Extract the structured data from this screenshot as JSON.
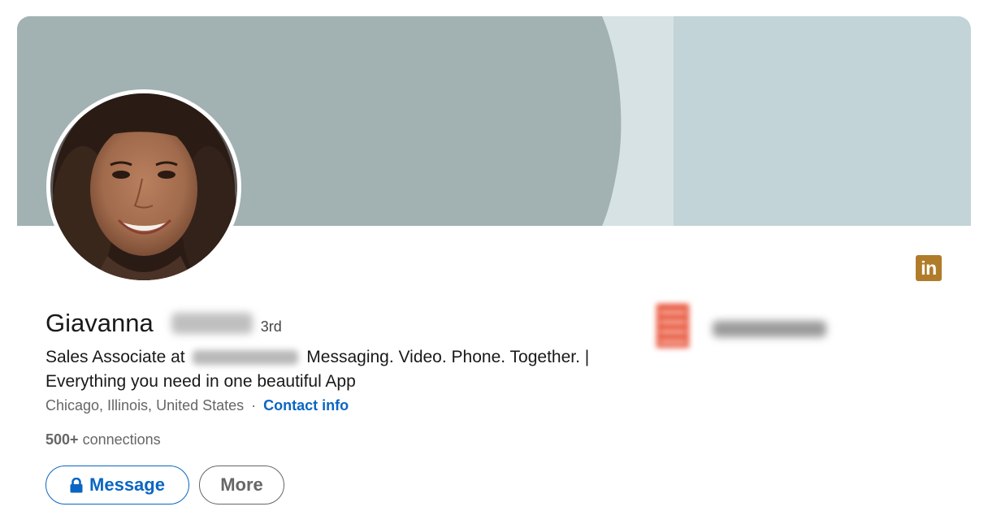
{
  "profile": {
    "first_name": "Giavanna",
    "degree": "3rd",
    "headline_prefix": "Sales Associate at",
    "headline_suffix": "Messaging. Video. Phone. Together. | Everything you need in one beautiful App",
    "location": "Chicago, Illinois, United States",
    "separator": "·",
    "contact_info": "Contact info",
    "connections_count": "500+",
    "connections_label": "connections"
  },
  "actions": {
    "message_label": "Message",
    "more_label": "More"
  },
  "badge": {
    "label": "in",
    "icon": "linkedin-icon"
  },
  "colors": {
    "banner_main": "#a2b1b2",
    "banner_band": "#d6e2e3",
    "banner_right": "#c3d4d8",
    "link_blue": "#0a66c2",
    "badge_gold": "#b07c2a",
    "company_logo": "#e8543b"
  }
}
